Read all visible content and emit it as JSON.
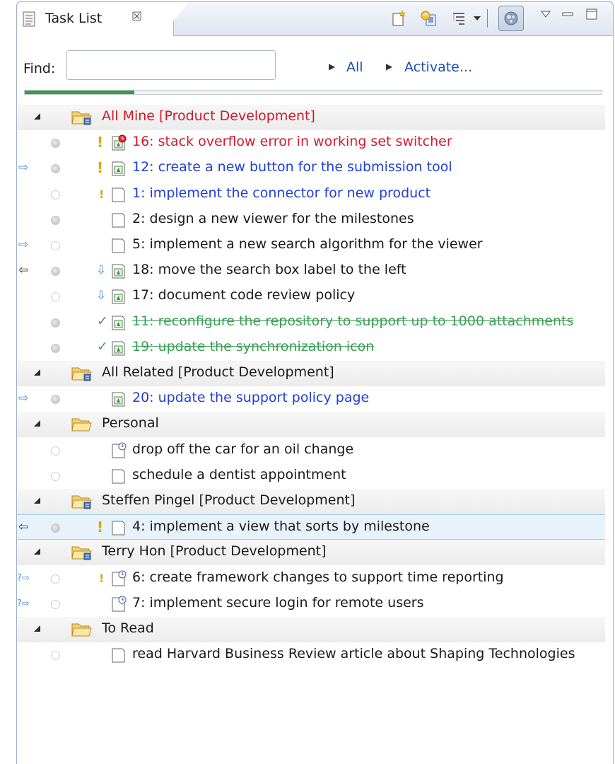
{
  "tab": {
    "title": "Task List",
    "close_glyph": "☒"
  },
  "toolbar": {
    "icons": [
      "new-task-icon",
      "synchronize-icon",
      "presentation-icon",
      "dropdown-icon",
      "focus-on-workweek-icon",
      "view-menu-icon",
      "minimize-icon",
      "maximize-icon"
    ]
  },
  "find": {
    "label": "Find:",
    "value": "",
    "placeholder": ""
  },
  "links": {
    "all": "All",
    "activate": "Activate..."
  },
  "progress": {
    "fraction": 0.19
  },
  "colors": {
    "overdue": "#d11a2a",
    "incoming": "#1f3fd8",
    "completed": "#3b9e54",
    "priority": "#e0a500"
  },
  "categories": [
    {
      "label": "All Mine",
      "suffix": "  [Product Development]",
      "color": "red",
      "shared": true
    },
    {
      "label": "All Related",
      "suffix": "  [Product Development]",
      "color": "dark",
      "shared": true
    },
    {
      "label": "Personal",
      "suffix": "",
      "color": "dark",
      "shared": false
    },
    {
      "label": "Steffen Pingel",
      "suffix": "  [Product Development]",
      "color": "dark",
      "shared": true
    },
    {
      "label": "Terry Hon",
      "suffix": "  [Product Development]",
      "color": "dark",
      "shared": true
    },
    {
      "label": "To Read",
      "suffix": "",
      "color": "dark",
      "shared": false
    }
  ],
  "tasks": [
    {
      "label": "16: stack overflow error in working set switcher",
      "style": "red",
      "nav": "",
      "dot": "filled",
      "marker": "prio",
      "icon": "repo-overdue"
    },
    {
      "label": "12: create a new button for the submission tool",
      "style": "blue",
      "nav": "right",
      "dot": "filled",
      "marker": "prio",
      "icon": "repo"
    },
    {
      "label": "1: implement the connector for new product",
      "style": "blue",
      "nav": "",
      "dot": "empty",
      "marker": "prio-low",
      "icon": "local"
    },
    {
      "label": "2: design a new viewer for the milestones",
      "style": "dark",
      "nav": "",
      "dot": "filled",
      "marker": "",
      "icon": "local"
    },
    {
      "label": "5: implement a new search algorithm for the viewer",
      "style": "dark",
      "nav": "right",
      "dot": "empty",
      "marker": "",
      "icon": "local"
    },
    {
      "label": "18: move the search box label to the left",
      "style": "dark",
      "nav": "left",
      "dot": "filled",
      "marker": "incoming",
      "icon": "repo"
    },
    {
      "label": "17: document code review policy",
      "style": "dark",
      "nav": "",
      "dot": "empty",
      "marker": "incoming-new",
      "icon": "repo"
    },
    {
      "label": "11: reconfigure the repository to support up to 1000 attachments",
      "style": "done",
      "nav": "",
      "dot": "filled",
      "marker": "check",
      "icon": "repo"
    },
    {
      "label": "19: update the synchronization icon",
      "style": "done",
      "nav": "",
      "dot": "filled",
      "marker": "check",
      "icon": "repo"
    },
    {
      "label": "20: update the support policy page",
      "style": "blue",
      "nav": "right",
      "dot": "filled",
      "marker": "",
      "icon": "repo"
    },
    {
      "label": "drop off the car for an oil change",
      "style": "dark",
      "nav": "",
      "dot": "empty",
      "marker": "",
      "icon": "local-scheduled"
    },
    {
      "label": "schedule a dentist appointment",
      "style": "dark",
      "nav": "",
      "dot": "empty",
      "marker": "",
      "icon": "local"
    },
    {
      "label": "4: implement a view that sorts by milestone",
      "style": "dark",
      "nav": "left",
      "dot": "filled",
      "marker": "prio",
      "icon": "local"
    },
    {
      "label": "6: create framework changes to support time reporting",
      "style": "dark",
      "nav": "incoming",
      "dot": "empty",
      "marker": "prio-low",
      "icon": "local-scheduled"
    },
    {
      "label": "7: implement secure login for remote users",
      "style": "dark",
      "nav": "incoming",
      "dot": "empty",
      "marker": "",
      "icon": "local-scheduled"
    },
    {
      "label": "read Harvard Business Review article about Shaping Technologies",
      "style": "dark",
      "nav": "",
      "dot": "empty",
      "marker": "",
      "icon": "local"
    }
  ]
}
